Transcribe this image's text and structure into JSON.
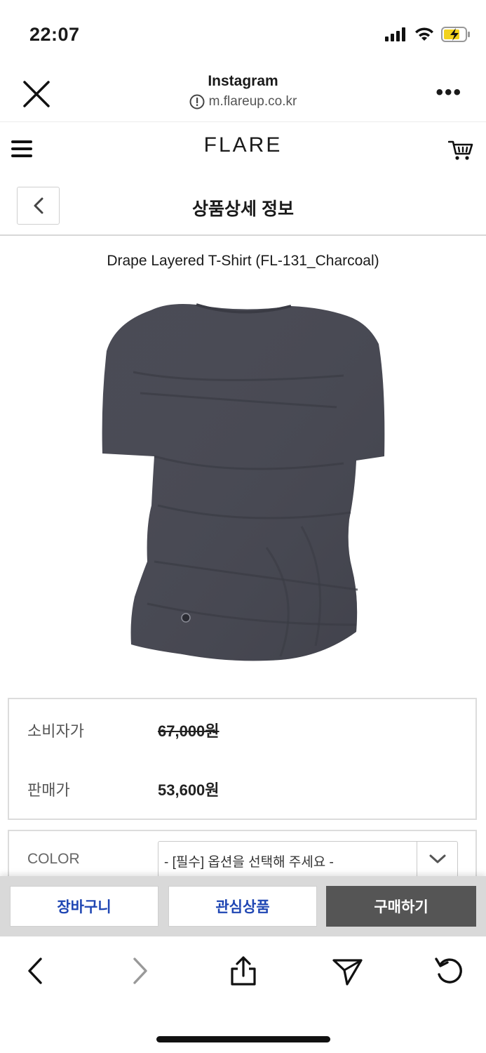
{
  "status_bar": {
    "time": "22:07",
    "icons": [
      "signal-icon",
      "wifi-icon",
      "battery-charging-icon"
    ]
  },
  "browser": {
    "title": "Instagram",
    "url": "m.flareup.co.kr",
    "icons": [
      "close-icon",
      "info-icon",
      "more-icon"
    ]
  },
  "site": {
    "logo": "FLARE",
    "icons": [
      "hamburger-menu-icon",
      "cart-icon"
    ]
  },
  "page": {
    "title": "상품상세 정보",
    "back_icon": "chevron-left-icon"
  },
  "product": {
    "name": "Drape Layered T-Shirt (FL-131_Charcoal)",
    "image_alt": "charcoal draped t-shirt",
    "color": "#4a4b55"
  },
  "prices": {
    "consumer_label": "소비자가",
    "consumer_value": "67,000원",
    "sale_label": "판매가",
    "sale_value": "53,600원"
  },
  "options": {
    "label": "COLOR",
    "select_value": "- [필수] 옵션을 선택해 주세요 -"
  },
  "actions": {
    "cart": "장바구니",
    "wishlist": "관심상품",
    "buy": "구매하기",
    "accent": "#1f46b3",
    "buy_bg": "#555555"
  },
  "toolbar": {
    "icons": [
      "back-icon",
      "forward-icon",
      "share-icon",
      "send-icon",
      "reload-icon"
    ]
  }
}
